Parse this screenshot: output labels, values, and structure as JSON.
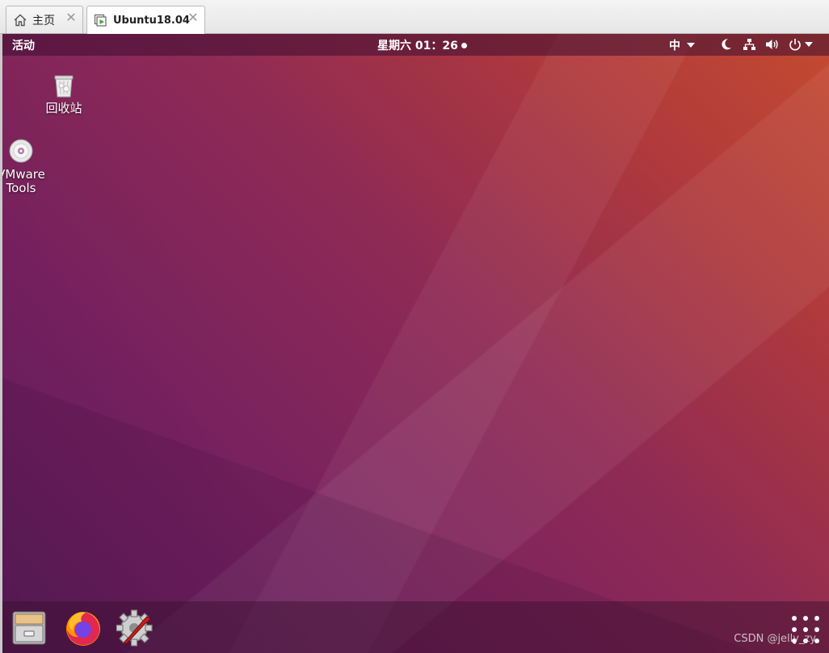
{
  "tabs": [
    {
      "label": "主页",
      "icon": "home-icon"
    },
    {
      "label": "Ubuntu18.04",
      "icon": "vm-play-icon"
    }
  ],
  "topbar": {
    "activities": "活动",
    "clock": "星期六 01：26",
    "input_method": "中"
  },
  "tray_icons": [
    "night-light-icon",
    "network-icon",
    "volume-icon",
    "power-icon"
  ],
  "desktop": {
    "trash_label": "回收站",
    "vmware_label_line1": "VMware",
    "vmware_label_line2": "Tools"
  },
  "dock": [
    "files-icon",
    "firefox-icon",
    "software-settings-icon",
    "show-applications-icon"
  ],
  "watermark": "CSDN @jelly_zy",
  "colors": {
    "accent": "#772160",
    "warm": "#c44a30"
  }
}
